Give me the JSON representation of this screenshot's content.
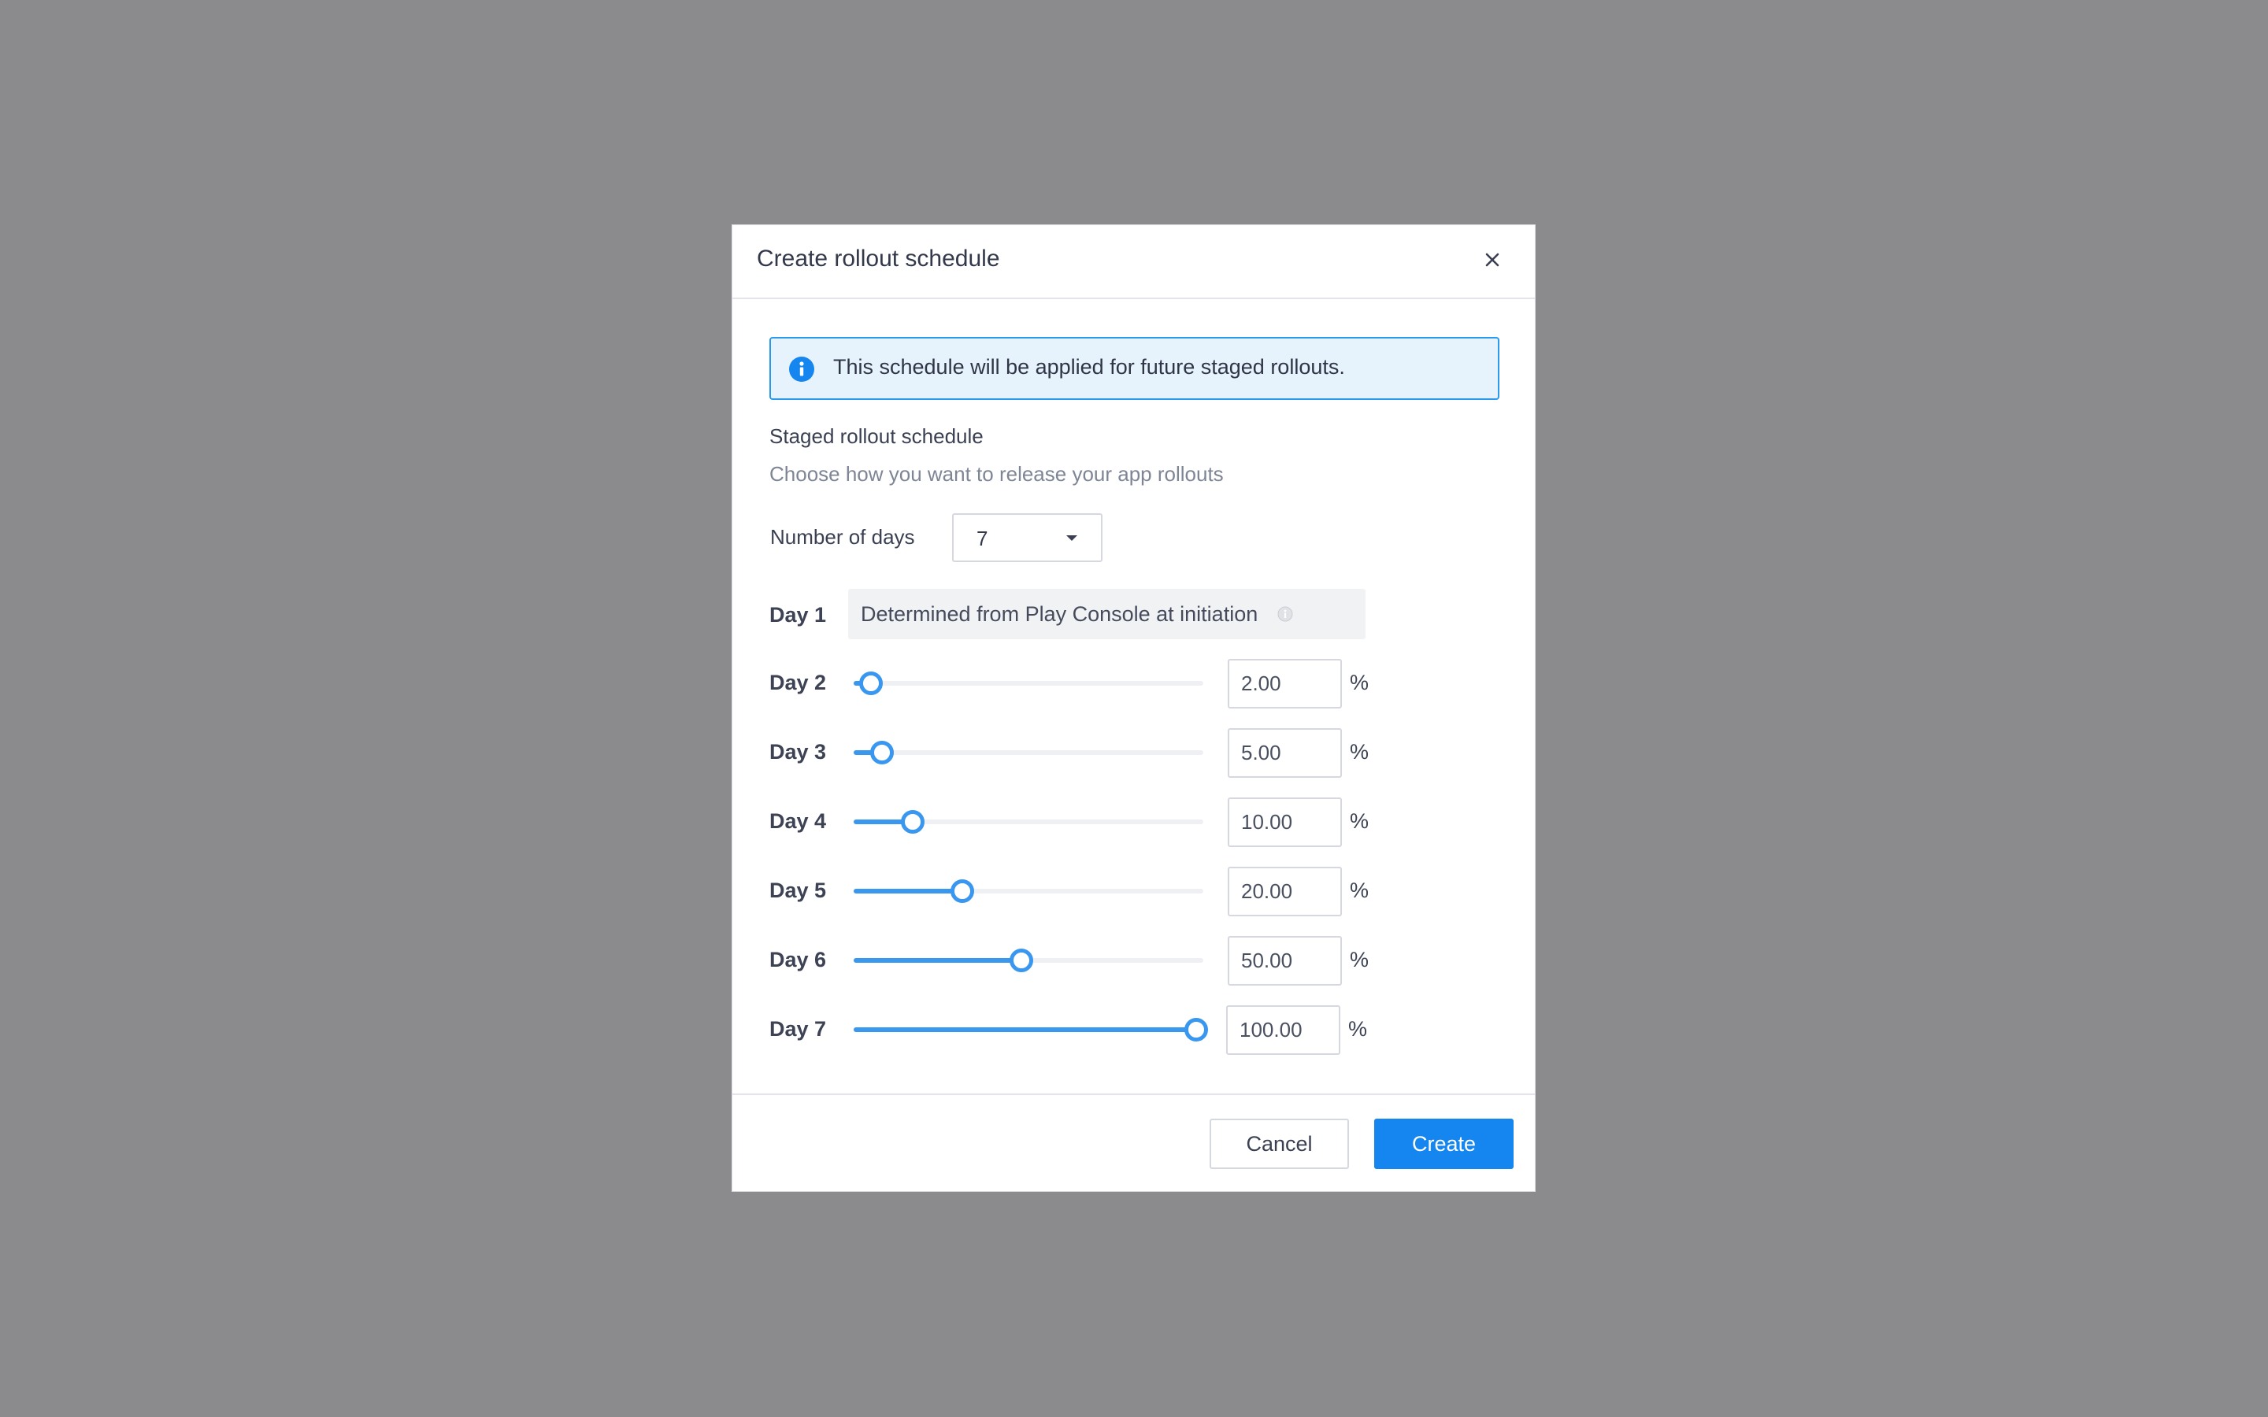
{
  "dialog": {
    "title": "Create rollout schedule",
    "close_icon": "close-icon"
  },
  "banner": {
    "icon": "info-icon",
    "text": "This schedule will be applied for future staged rollouts.",
    "accent": "#2a9bec",
    "background": "#e6f3fd"
  },
  "schedule": {
    "title": "Staged rollout schedule",
    "description": "Choose how you want to release your app rollouts",
    "days_label": "Number of days",
    "days_value": "7"
  },
  "day1": {
    "label": "Day 1",
    "text": "Determined from Play Console at initiation",
    "hint_icon": "info-hint-icon"
  },
  "rows": [
    {
      "label": "Day 2",
      "value": "2.00",
      "unit": "%",
      "level": 0.05
    },
    {
      "label": "Day 3",
      "value": "5.00",
      "unit": "%",
      "level": 0.08
    },
    {
      "label": "Day 4",
      "value": "10.00",
      "unit": "%",
      "level": 0.17
    },
    {
      "label": "Day 5",
      "value": "20.00",
      "unit": "%",
      "level": 0.31
    },
    {
      "label": "Day 6",
      "value": "50.00",
      "unit": "%",
      "level": 0.48
    },
    {
      "label": "Day 7",
      "value": "100.00",
      "unit": "%",
      "level": 0.98
    }
  ],
  "footer": {
    "cancel_label": "Cancel",
    "create_label": "Create"
  },
  "colors": {
    "primary": "#1586f0",
    "slider": "#3a97f0",
    "backdrop": "#8b8b8d"
  }
}
